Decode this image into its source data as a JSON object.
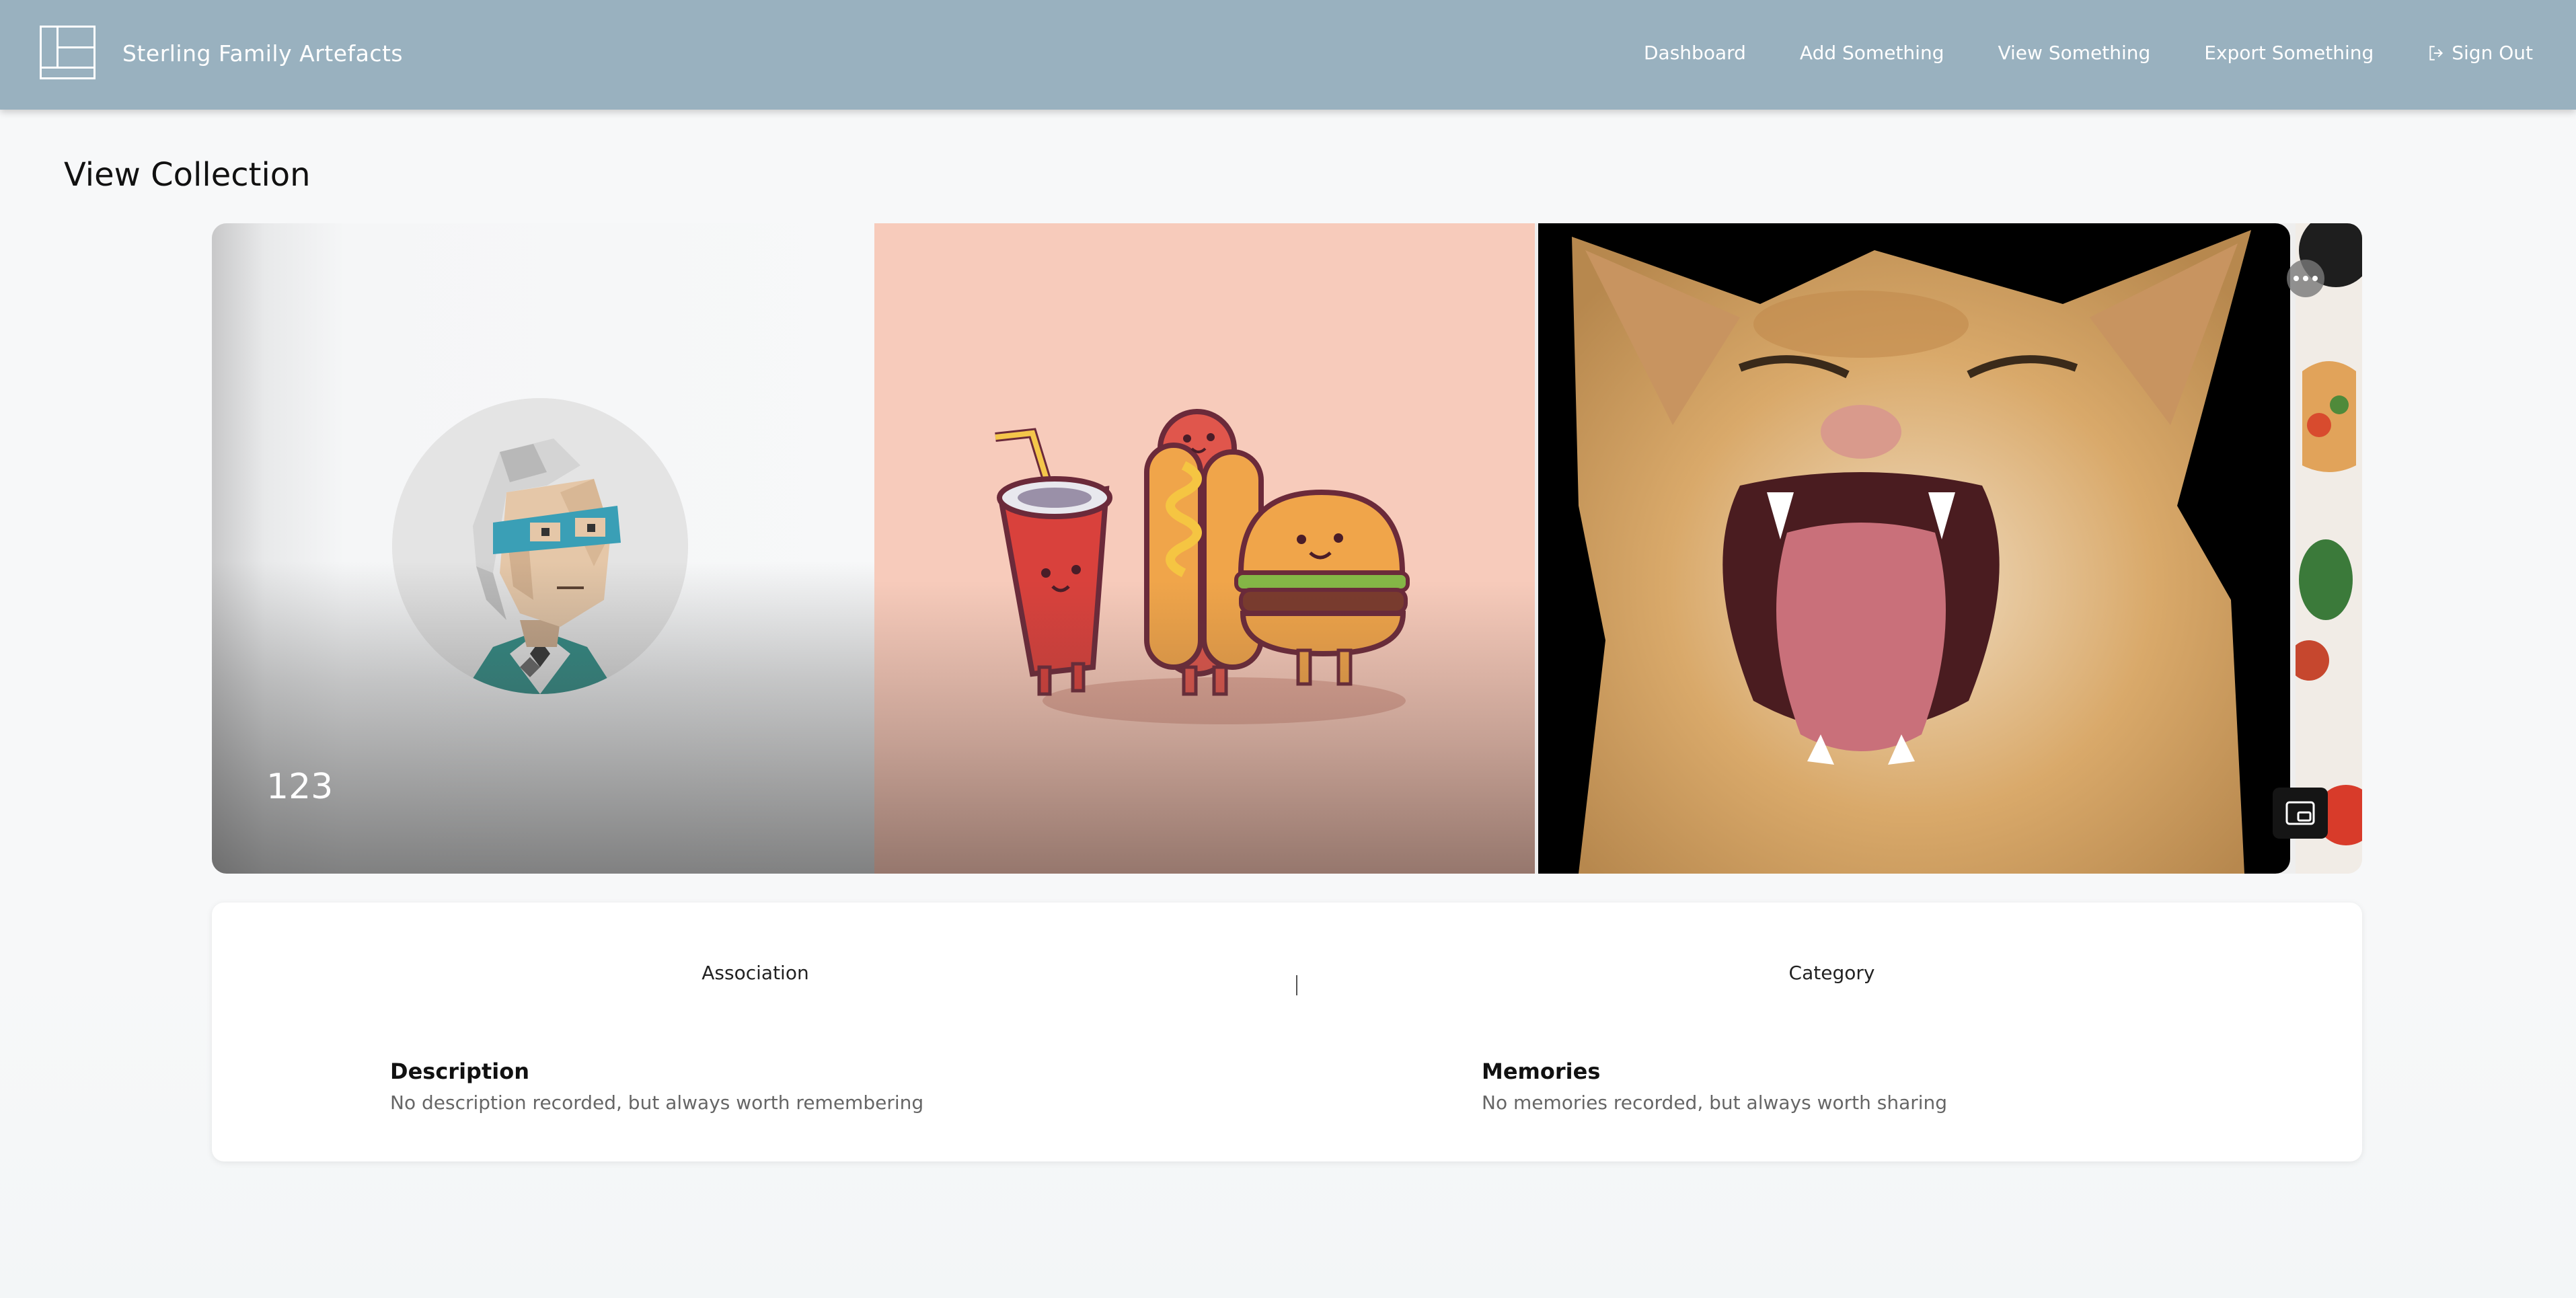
{
  "header": {
    "brand": "Sterling Family Artefacts",
    "nav": {
      "dashboard": "Dashboard",
      "add": "Add Something",
      "view": "View Something",
      "export": "Export Something",
      "signout": "Sign Out"
    }
  },
  "page": {
    "title": "View Collection"
  },
  "carousel": {
    "slides": [
      {
        "caption": "123",
        "image": "avatar-illustration"
      },
      {
        "caption": "",
        "image": "food-characters-illustration"
      },
      {
        "caption": "",
        "image": "cat-photo"
      },
      {
        "caption": "",
        "image": "food-photo"
      }
    ],
    "controls": {
      "more_icon": "more-icon",
      "pip_icon": "picture-in-picture-icon"
    }
  },
  "details": {
    "association_label": "Association",
    "category_label": "Category",
    "description_heading": "Description",
    "description_text": "No description recorded, but always worth remembering",
    "memories_heading": "Memories",
    "memories_text": "No memories recorded, but always worth sharing"
  },
  "colors": {
    "header_bg": "#99b1bf",
    "page_bg": "#f7f8f9",
    "slide_peach": "#f7cbbb"
  }
}
